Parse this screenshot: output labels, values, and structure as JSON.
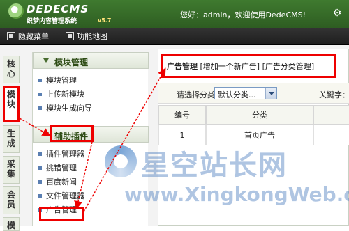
{
  "header": {
    "logo_main": "DEDECMS",
    "logo_sub": "织梦内容管理系统",
    "version": "v5.7",
    "welcome": "您好：admin，欢迎使用DedeCMS!",
    "gear_icon": "gear-icon"
  },
  "menubar": {
    "hide_menu": "隐藏菜单",
    "site_map": "功能地图"
  },
  "sidetabs": [
    {
      "label": "核心"
    },
    {
      "label": "模块"
    },
    {
      "label": "生成"
    },
    {
      "label": "采集"
    },
    {
      "label": "会员"
    },
    {
      "label": "模"
    }
  ],
  "panel1": {
    "title": "模块管理",
    "items": [
      "模块管理",
      "上传新模块",
      "模块生成向导"
    ]
  },
  "panel2": {
    "title": "辅助插件",
    "items": [
      "插件管理器",
      "挑错管理",
      "百度新闻",
      "文件管理器",
      "广告管理"
    ]
  },
  "main": {
    "title": "广告管理",
    "link_add": "增加一个新广告",
    "link_cat": "广告分类管理",
    "select_label": "请选择分类：",
    "select_value": "默认分类...",
    "keyword_label": "关键字：",
    "table": {
      "headers": [
        "编号",
        "分类"
      ],
      "rows": [
        [
          "1",
          "首页广告"
        ]
      ]
    }
  },
  "watermark": {
    "cn": "星空站长网",
    "url": "www.XingkongWeb.com"
  },
  "colors": {
    "top_green": "#3f7a2f",
    "highlight_red": "#e00000"
  }
}
